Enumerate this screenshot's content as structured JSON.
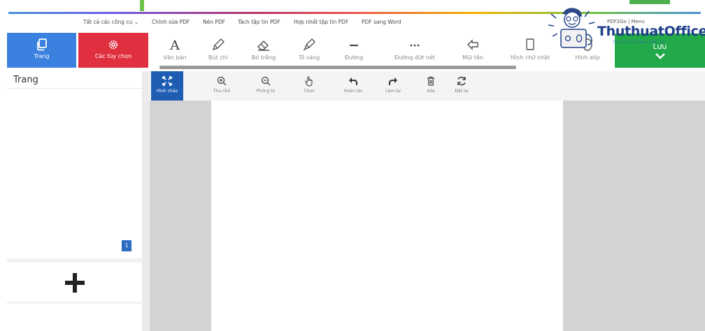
{
  "nav": {
    "links": [
      "Tất cả các công cụ",
      "Chỉnh sửa PDF",
      "Nén PDF",
      "Tách tập tin PDF",
      "Hợp nhất tập tin PDF",
      "PDF sang Word"
    ],
    "right": "PDF2Go | Menu"
  },
  "sidebar_buttons": {
    "pages": "Trang",
    "options": "Các tùy chọn"
  },
  "tools": [
    {
      "label": "Văn bản",
      "icon": "text-icon"
    },
    {
      "label": "Bút chì",
      "icon": "pencil-icon"
    },
    {
      "label": "Bỏ trắng",
      "icon": "eraser-icon"
    },
    {
      "label": "Tô sáng",
      "icon": "highlighter-icon"
    },
    {
      "label": "Đường",
      "icon": "line-icon"
    },
    {
      "label": "Đường đứt nét",
      "icon": "dashed-line-icon"
    },
    {
      "label": "Mũi tên",
      "icon": "arrow-icon"
    },
    {
      "label": "Hình chữ nhật",
      "icon": "rectangle-icon"
    },
    {
      "label": "Hình elip",
      "icon": "ellipse-icon"
    }
  ],
  "save": {
    "label": "Lưu"
  },
  "logo": {
    "word": "ThuthuatOffice",
    "tagline": "TRI KỶ CỦA DÂN CÔNG SỞ"
  },
  "left_panel": {
    "title": "Trang",
    "page_badge": "1",
    "add_symbol": "+"
  },
  "viewer_tools": [
    {
      "label": "Hình chảo",
      "icon": "fit-icon",
      "active": true
    },
    {
      "label": "Thu nhỏ",
      "icon": "zoom-in-icon"
    },
    {
      "label": "Phóng to",
      "icon": "zoom-out-icon"
    },
    {
      "label": "Chọn",
      "icon": "hand-pointer-icon"
    },
    {
      "label": "Hoàn tác",
      "icon": "undo-icon"
    },
    {
      "label": "Làm lại",
      "icon": "redo-icon"
    },
    {
      "label": "Xóa",
      "icon": "trash-icon"
    },
    {
      "label": "Đặt lại",
      "icon": "reset-icon"
    }
  ],
  "colors": {
    "blue": "#3b82e0",
    "red": "#e0303f",
    "green": "#22a94a",
    "active_tool": "#1f5db5"
  }
}
